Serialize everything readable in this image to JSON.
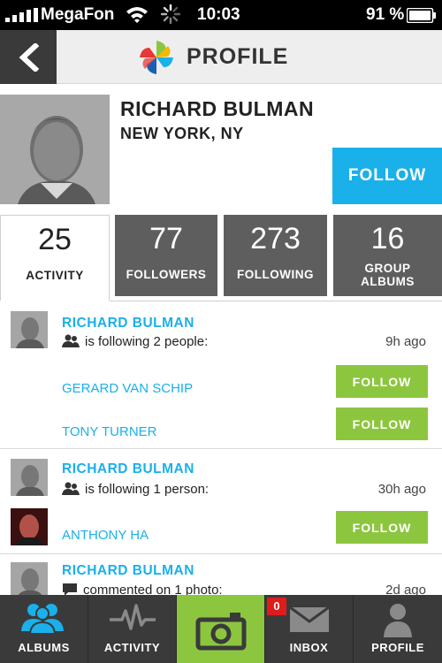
{
  "status_bar": {
    "carrier": "MegaFon",
    "time": "10:03",
    "battery": "91 %"
  },
  "header": {
    "title": "PROFILE",
    "back_icon": "chevron-left-icon",
    "logo_icon": "pinwheel-logo"
  },
  "profile": {
    "name": "RICHARD BULMAN",
    "location": "NEW YORK, NY",
    "follow_label": "FOLLOW",
    "accent": "#1ab0ea"
  },
  "stats": [
    {
      "value": "25",
      "label": "ACTIVITY"
    },
    {
      "value": "77",
      "label": "FOLLOWERS"
    },
    {
      "value": "273",
      "label": "FOLLOWING"
    },
    {
      "value": "16",
      "label": "GROUP ALBUMS"
    }
  ],
  "feed": [
    {
      "name": "RICHARD BULMAN",
      "action": "is following 2 people:",
      "time": "9h ago",
      "people": [
        {
          "name": "GERARD VAN SCHIP",
          "button": "FOLLOW"
        },
        {
          "name": "TONY TURNER",
          "button": "FOLLOW"
        }
      ]
    },
    {
      "name": "RICHARD BULMAN",
      "action": "is following 1 person:",
      "time": "30h ago",
      "people": [
        {
          "name": "ANTHONY HA",
          "button": "FOLLOW"
        }
      ]
    },
    {
      "name": "RICHARD BULMAN",
      "action": "commented on 1 photo:",
      "time": "2d ago"
    }
  ],
  "tabbar": {
    "albums": "ALBUMS",
    "activity": "ACTIVITY",
    "inbox": "INBOX",
    "inbox_badge": "0",
    "profile": "PROFILE"
  },
  "colors": {
    "accent_blue": "#1ab0ea",
    "follow_green": "#8cc63f",
    "dark": "#3a3a3a",
    "badge_red": "#e01b1b"
  }
}
